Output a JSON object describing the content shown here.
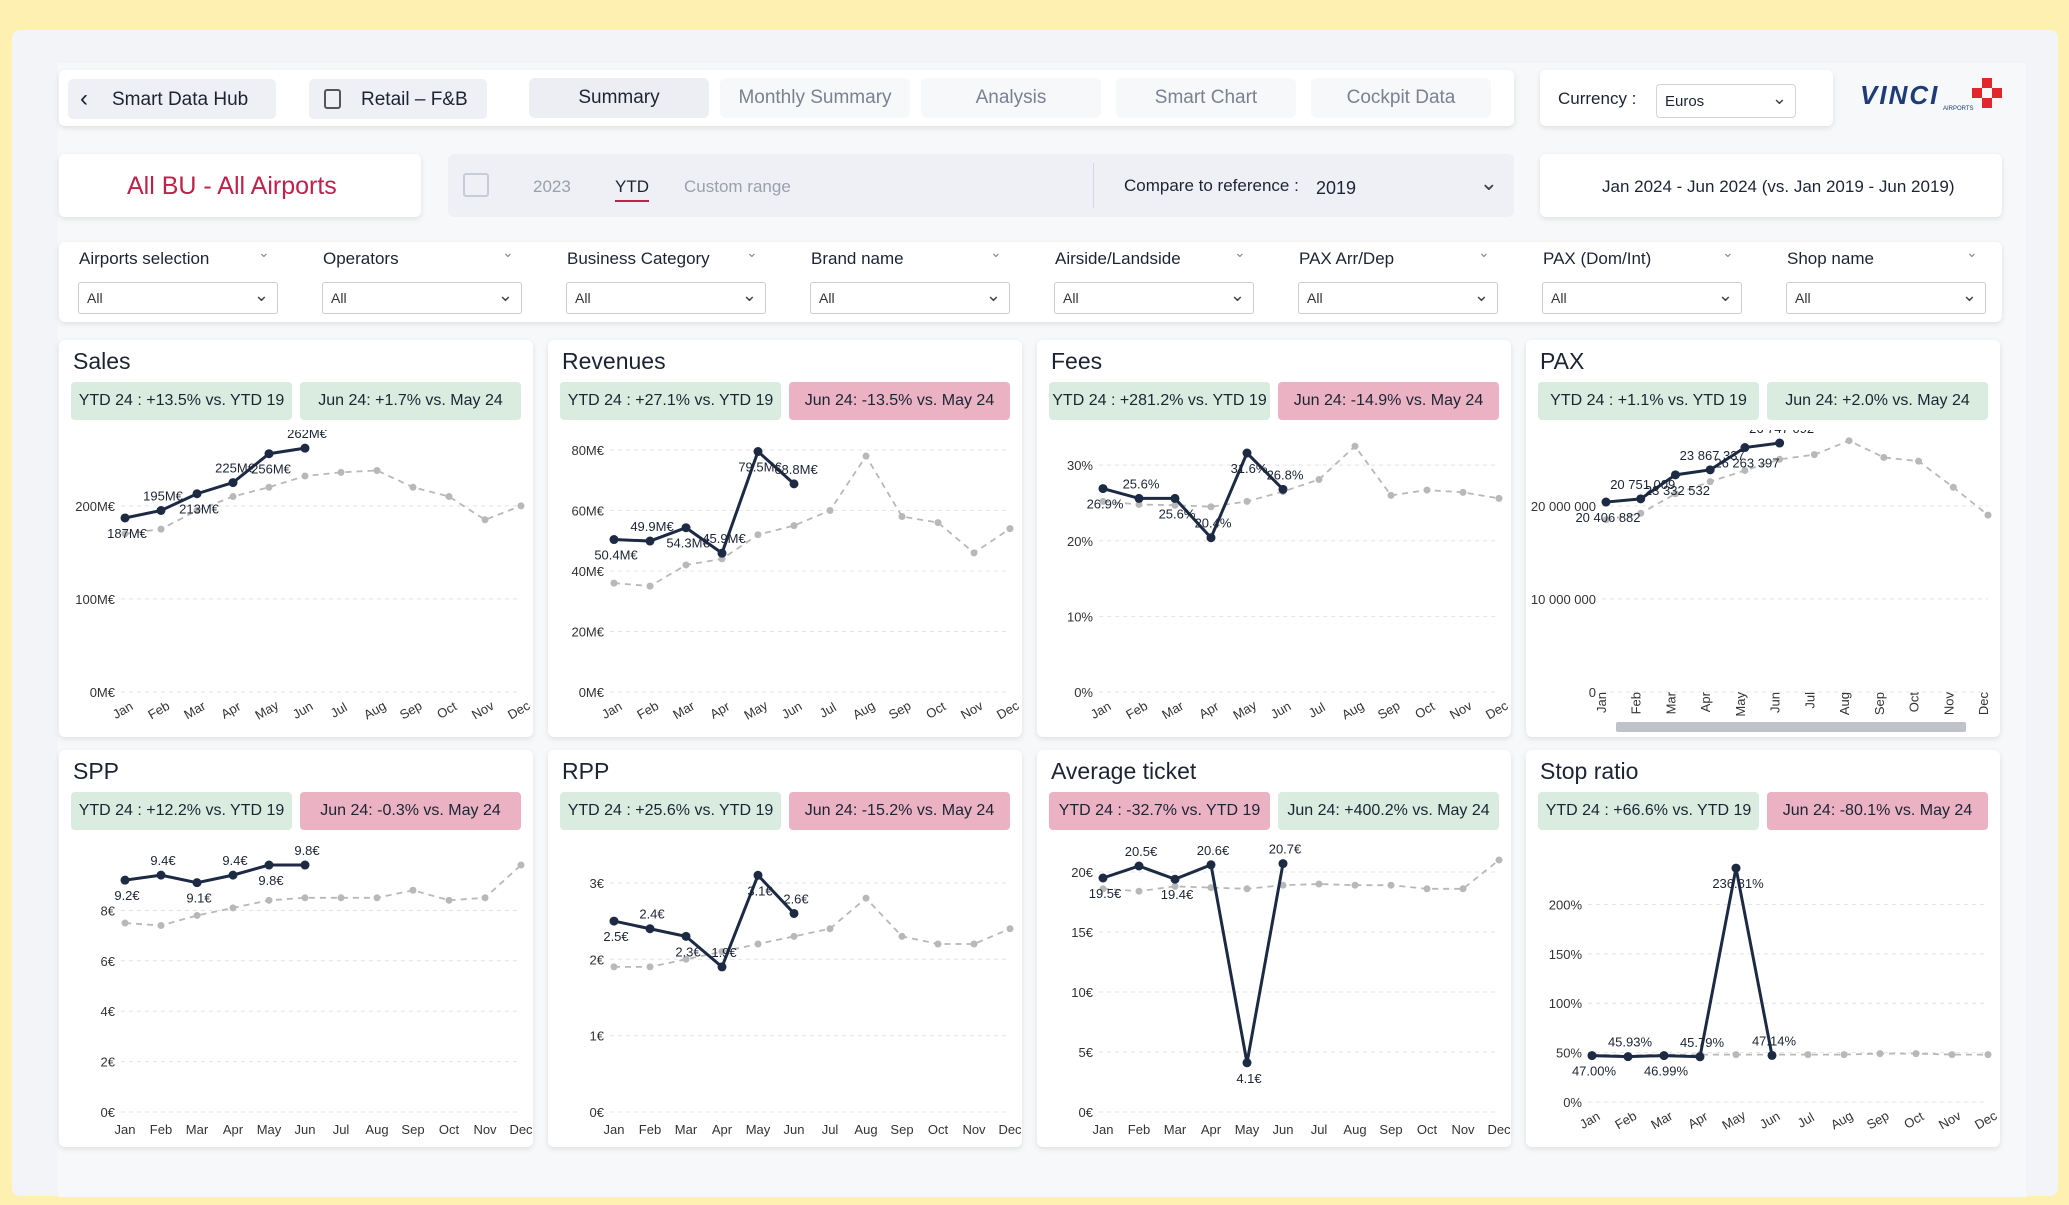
{
  "nav": {
    "back_label": "Smart Data Hub",
    "retail_label": "Retail – F&B",
    "tabs": [
      "Summary",
      "Monthly Summary",
      "Analysis",
      "Smart Chart",
      "Cockpit Data"
    ],
    "currency_label": "Currency :",
    "currency_value": "Euros"
  },
  "brand": {
    "name": "VINCI",
    "sub": "AIRPORTS"
  },
  "scope": {
    "title": "All BU - All Airports",
    "periods": [
      "2023",
      "YTD",
      "Custom range"
    ],
    "compare_label": "Compare to reference :",
    "compare_value": "2019",
    "date_range": "Jan 2024 - Jun 2024 (vs. Jan 2019 - Jun 2019)"
  },
  "filters": [
    {
      "label": "Airports selection",
      "value": "All"
    },
    {
      "label": "Operators",
      "value": "All"
    },
    {
      "label": "Business Category",
      "value": "All"
    },
    {
      "label": "Brand name",
      "value": "All"
    },
    {
      "label": "Airside/Landside",
      "value": "All"
    },
    {
      "label": "PAX Arr/Dep",
      "value": "All"
    },
    {
      "label": "PAX (Dom/Int)",
      "value": "All"
    },
    {
      "label": "Shop name",
      "value": "All"
    }
  ],
  "colors": {
    "accent": "#c0214a",
    "badge_green": "#d9ecdf",
    "badge_red": "#eab2c3",
    "series_current": "#1c2a44",
    "series_reference": "#b8b8b8"
  },
  "chart_data": [
    {
      "type": "line",
      "title": "Sales",
      "badge_ytd": "YTD 24 : +13.5% vs. YTD 19",
      "badge_ytd_color": "green",
      "badge_month": "Jun 24: +1.7% vs. May 24",
      "badge_month_color": "green",
      "categories": [
        "Jan",
        "Feb",
        "Mar",
        "Apr",
        "May",
        "Jun",
        "Jul",
        "Aug",
        "Sep",
        "Oct",
        "Nov",
        "Dec"
      ],
      "ylim": [
        0,
        260
      ],
      "yticks": [
        0,
        100,
        200
      ],
      "yticklabels": [
        "0M€",
        "100M€",
        "200M€"
      ],
      "xlabel_rotated": true,
      "series": [
        {
          "values": [
            187,
            195,
            213,
            225,
            256,
            262,
            null,
            null,
            null,
            null,
            null,
            null
          ],
          "labels": [
            "187M€",
            "195M€",
            "213M€",
            "225M€",
            "256M€",
            "262M€",
            null,
            null,
            null,
            null,
            null,
            null
          ]
        },
        {
          "values": [
            170,
            175,
            195,
            210,
            220,
            232,
            236,
            238,
            220,
            210,
            185,
            200
          ]
        }
      ]
    },
    {
      "type": "line",
      "title": "Revenues",
      "badge_ytd": "YTD 24 : +27.1% vs. YTD 19",
      "badge_ytd_color": "green",
      "badge_month": "Jun 24: -13.5% vs. May 24",
      "badge_month_color": "red",
      "categories": [
        "Jan",
        "Feb",
        "Mar",
        "Apr",
        "May",
        "Jun",
        "Jul",
        "Aug",
        "Sep",
        "Oct",
        "Nov",
        "Dec"
      ],
      "ylim": [
        0,
        80
      ],
      "yticks": [
        0,
        20,
        40,
        60,
        80
      ],
      "yticklabels": [
        "0M€",
        "20M€",
        "40M€",
        "60M€",
        "80M€"
      ],
      "xlabel_rotated": true,
      "series": [
        {
          "values": [
            50.4,
            49.9,
            54.3,
            45.9,
            79.5,
            68.8,
            null,
            null,
            null,
            null,
            null,
            null
          ],
          "labels": [
            "50.4M€",
            "49.9M€",
            "54.3M€",
            "45.9M€",
            "79.5M€",
            "68.8M€",
            null,
            null,
            null,
            null,
            null,
            null
          ]
        },
        {
          "values": [
            36,
            35,
            42,
            44,
            52,
            55,
            60,
            78,
            58,
            56,
            46,
            54
          ]
        }
      ]
    },
    {
      "type": "line",
      "title": "Fees",
      "badge_ytd": "YTD 24 : +281.2% vs. YTD 19",
      "badge_ytd_color": "green",
      "badge_month": "Jun 24: -14.9% vs. May 24",
      "badge_month_color": "red",
      "categories": [
        "Jan",
        "Feb",
        "Mar",
        "Apr",
        "May",
        "Jun",
        "Jul",
        "Aug",
        "Sep",
        "Oct",
        "Nov",
        "Dec"
      ],
      "ylim": [
        0,
        32
      ],
      "yticks": [
        0,
        10,
        20,
        30
      ],
      "yticklabels": [
        "0%",
        "10%",
        "20%",
        "30%"
      ],
      "xlabel_rotated": true,
      "series": [
        {
          "values": [
            26.9,
            25.6,
            25.6,
            20.4,
            31.6,
            26.8,
            null,
            null,
            null,
            null,
            null,
            null
          ],
          "labels": [
            "26.9%",
            "25.6%",
            "25.6%",
            "20.4%",
            "31.6%",
            "26.8%",
            null,
            null,
            null,
            null,
            null,
            null
          ]
        },
        {
          "values": [
            25.2,
            24.8,
            24.7,
            24.5,
            25.2,
            26.5,
            28.1,
            32.5,
            26.0,
            26.7,
            26.4,
            25.6
          ]
        }
      ]
    },
    {
      "type": "line",
      "title": "PAX",
      "badge_ytd": "YTD 24 : +1.1% vs. YTD 19",
      "badge_ytd_color": "green",
      "badge_month": "Jun 24: +2.0% vs. May 24",
      "badge_month_color": "green",
      "categories": [
        "Jan",
        "Feb",
        "Mar",
        "Apr",
        "May",
        "Jun",
        "Jul",
        "Aug",
        "Sep",
        "Oct",
        "Nov",
        "Dec"
      ],
      "ylim": [
        0,
        26000000
      ],
      "yticks": [
        0,
        10000000,
        20000000
      ],
      "yticklabels": [
        "0",
        "10 000 000",
        "20 000 000"
      ],
      "xlabel_rotated": true,
      "series": [
        {
          "values": [
            20406882,
            20751009,
            23332532,
            23867337,
            26263397,
            26747092,
            null,
            null,
            null,
            null,
            null,
            null
          ],
          "labels": [
            "20 406 882",
            "20 751 009",
            "23 332 532",
            "23 867 337",
            "26 263 397",
            "26 747 092",
            null,
            null,
            null,
            null,
            null,
            null
          ]
        },
        {
          "values": [
            18500000,
            19200000,
            21300000,
            22600000,
            23800000,
            25000000,
            25500000,
            27000000,
            25200000,
            24800000,
            22000000,
            19000000
          ]
        }
      ]
    },
    {
      "type": "line",
      "title": "SPP",
      "badge_ytd": "YTD 24 : +12.2% vs. YTD 19",
      "badge_ytd_color": "green",
      "badge_month": "Jun 24: -0.3% vs. May 24",
      "badge_month_color": "red",
      "categories": [
        "Jan",
        "Feb",
        "Mar",
        "Apr",
        "May",
        "Jun",
        "Jul",
        "Aug",
        "Sep",
        "Oct",
        "Nov",
        "Dec"
      ],
      "ylim": [
        0,
        10
      ],
      "yticks": [
        0,
        2,
        4,
        6,
        8
      ],
      "yticklabels": [
        "0€",
        "2€",
        "4€",
        "6€",
        "8€"
      ],
      "xlabel_rotated": false,
      "series": [
        {
          "values": [
            9.2,
            9.4,
            9.1,
            9.4,
            9.8,
            9.8,
            null,
            null,
            null,
            null,
            null,
            null
          ],
          "labels": [
            "9.2€",
            "9.4€",
            "9.1€",
            "9.4€",
            "9.8€",
            "9.8€",
            null,
            null,
            null,
            null,
            null,
            null
          ]
        },
        {
          "values": [
            7.5,
            7.4,
            7.8,
            8.1,
            8.4,
            8.5,
            8.5,
            8.5,
            8.8,
            8.4,
            8.5,
            9.8
          ]
        }
      ]
    },
    {
      "type": "line",
      "title": "RPP",
      "badge_ytd": "YTD 24 : +25.6% vs. YTD 19",
      "badge_ytd_color": "green",
      "badge_month": "Jun 24: -15.2% vs. May 24",
      "badge_month_color": "red",
      "categories": [
        "Jan",
        "Feb",
        "Mar",
        "Apr",
        "May",
        "Jun",
        "Jul",
        "Aug",
        "Sep",
        "Oct",
        "Nov",
        "Dec"
      ],
      "ylim": [
        0,
        3.3
      ],
      "yticks": [
        0,
        1,
        2,
        3
      ],
      "yticklabels": [
        "0€",
        "1€",
        "2€",
        "3€"
      ],
      "xlabel_rotated": false,
      "series": [
        {
          "values": [
            2.5,
            2.4,
            2.3,
            1.9,
            3.1,
            2.6,
            null,
            null,
            null,
            null,
            null,
            null
          ],
          "labels": [
            "2.5€",
            "2.4€",
            "2.3€",
            "1.9€",
            "3.1€",
            "2.6€",
            null,
            null,
            null,
            null,
            null,
            null
          ]
        },
        {
          "values": [
            1.9,
            1.9,
            2.0,
            2.1,
            2.2,
            2.3,
            2.4,
            2.8,
            2.3,
            2.2,
            2.2,
            2.4
          ]
        }
      ]
    },
    {
      "type": "line",
      "title": "Average ticket",
      "badge_ytd": "YTD 24 : -32.7% vs. YTD 19",
      "badge_ytd_color": "red",
      "badge_month": "Jun 24: +400.2% vs. May 24",
      "badge_month_color": "green",
      "categories": [
        "Jan",
        "Feb",
        "Mar",
        "Apr",
        "May",
        "Jun",
        "Jul",
        "Aug",
        "Sep",
        "Oct",
        "Nov",
        "Dec"
      ],
      "ylim": [
        0,
        21
      ],
      "yticks": [
        0,
        5,
        10,
        15,
        20
      ],
      "yticklabels": [
        "0€",
        "5€",
        "10€",
        "15€",
        "20€"
      ],
      "xlabel_rotated": false,
      "series": [
        {
          "values": [
            19.5,
            20.5,
            19.4,
            20.6,
            4.1,
            20.7,
            null,
            null,
            null,
            null,
            null,
            null
          ],
          "labels": [
            "19.5€",
            "20.5€",
            "19.4€",
            "20.6€",
            "4.1€",
            "20.7€",
            null,
            null,
            null,
            null,
            null,
            null
          ]
        },
        {
          "values": [
            18.6,
            18.4,
            18.8,
            18.7,
            18.6,
            18.9,
            19.0,
            18.9,
            18.9,
            18.6,
            18.6,
            21.0
          ]
        }
      ]
    },
    {
      "type": "line",
      "title": "Stop ratio",
      "badge_ytd": "YTD 24 : +66.6% vs. YTD 19",
      "badge_ytd_color": "green",
      "badge_month": "Jun 24: -80.1% vs. May 24",
      "badge_month_color": "red",
      "categories": [
        "Jan",
        "Feb",
        "Mar",
        "Apr",
        "May",
        "Jun",
        "Jul",
        "Aug",
        "Sep",
        "Oct",
        "Nov",
        "Dec"
      ],
      "ylim": [
        0,
        245
      ],
      "yticks": [
        0,
        50,
        100,
        150,
        200
      ],
      "yticklabels": [
        "0%",
        "50%",
        "100%",
        "150%",
        "200%"
      ],
      "xlabel_rotated": true,
      "series": [
        {
          "values": [
            47.0,
            45.93,
            46.99,
            45.79,
            236.81,
            47.14,
            null,
            null,
            null,
            null,
            null,
            null
          ],
          "labels": [
            "47.00%",
            "45.93%",
            "46.99%",
            "45.79%",
            "236.81%",
            "47.14%",
            null,
            null,
            null,
            null,
            null,
            null
          ]
        },
        {
          "values": [
            48,
            47,
            48,
            48,
            48,
            48,
            48,
            48,
            49,
            49,
            48,
            48
          ]
        }
      ]
    }
  ]
}
